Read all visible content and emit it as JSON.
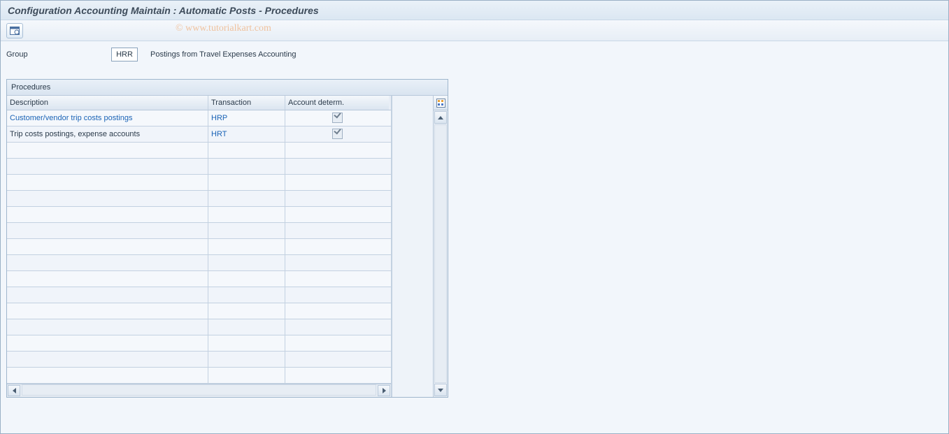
{
  "window": {
    "title": "Configuration Accounting Maintain : Automatic Posts - Procedures"
  },
  "watermark": "© www.tutorialkart.com",
  "toolbar": {
    "detail_icon": "detail-view-icon"
  },
  "group": {
    "label": "Group",
    "value": "HRR",
    "description": "Postings from Travel Expenses Accounting"
  },
  "panel": {
    "title": "Procedures"
  },
  "table": {
    "columns": {
      "description": "Description",
      "transaction": "Transaction",
      "account_determ": "Account determ."
    },
    "rows": [
      {
        "description": "Customer/vendor trip costs postings",
        "transaction": "HRP",
        "account_determ": true,
        "link": true
      },
      {
        "description": "Trip costs postings, expense accounts",
        "transaction": "HRT",
        "account_determ": true,
        "link": false
      }
    ],
    "empty_rows": 15
  }
}
